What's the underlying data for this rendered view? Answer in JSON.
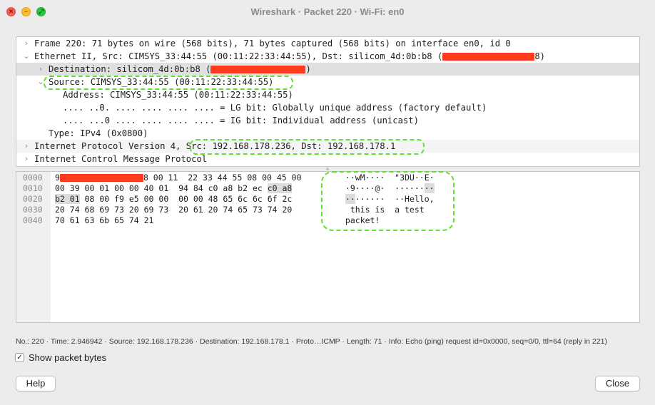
{
  "window": {
    "title": "Wireshark · Packet 220 · Wi-Fi: en0",
    "close_glyph": "✕",
    "minimize_glyph": "−",
    "zoom_glyph": "⤢"
  },
  "colors": {
    "annotation": "#5de02e",
    "redaction": "#ff3b1f",
    "selected_row": "#e0e0e0"
  },
  "details": {
    "rows": [
      {
        "chevron": "›",
        "text": "Frame 220: 71 bytes on wire (568 bits), 71 bytes captured (568 bits) on interface en0, id 0"
      },
      {
        "chevron": "⌄",
        "text": "Ethernet II, Src: CIMSYS_33:44:55 (00:11:22:33:44:55), Dst: silicom_4d:0b:b8 (",
        "suffix": "8)"
      },
      {
        "chevron": "›",
        "text": "Destination: silicom_4d:0b:b8 (",
        "suffix": ")"
      },
      {
        "chevron": "⌄",
        "text": "Source: CIMSYS_33:44:55 (00:11:22:33:44:55)"
      },
      {
        "text": "Address: CIMSYS_33:44:55 (00:11:22:33:44:55)"
      },
      {
        "text": ".... ..0. .... .... .... .... = LG bit: Globally unique address (factory default)"
      },
      {
        "text": ".... ...0 .... .... .... .... = IG bit: Individual address (unicast)"
      },
      {
        "text": "Type: IPv4 (0x0800)"
      },
      {
        "chevron": "›",
        "text": "Internet Protocol Version 4, Src: 192.168.178.236, Dst: 192.168.178.1"
      },
      {
        "chevron": "›",
        "text": "Internet Control Message Protocol"
      }
    ]
  },
  "bytes": {
    "offsets": [
      "0000",
      "0010",
      "0020",
      "0030",
      "0040"
    ],
    "hex": [
      {
        "pre": "9",
        "post": "8 00 11  22 33 44 55 08 00 45 00"
      },
      {
        "pre": "00 39 00 01 00 00 40 01  94 84 c0 a8 b2 ec ",
        "hl": "c0 a8",
        "post": ""
      },
      {
        "pre": "",
        "hl": "b2 01",
        "post": " 08 00 f9 e5 00 00  00 00 48 65 6c 6c 6f 2c"
      },
      {
        "pre": "20 74 68 69 73 20 69 73  20 61 20 74 65 73 74 20",
        "post": ""
      },
      {
        "pre": "70 61 63 6b 65 74 21",
        "post": ""
      }
    ],
    "ascii": [
      {
        "pre": " ··wM····  \"3DU··E·",
        "hl": "",
        "post": ""
      },
      {
        "pre": " ·9····@·  ······",
        "hl": "··",
        "post": ""
      },
      {
        "pre": " ",
        "hl": "··",
        "post": "······  ··Hello,"
      },
      {
        "pre": "  this is  a test",
        "hl": "",
        "post": ""
      },
      {
        "pre": " packet!",
        "hl": "",
        "post": ""
      }
    ]
  },
  "status": {
    "text": "No.: 220 · Time: 2.946942 · Source: 192.168.178.236 · Destination: 192.168.178.1 · Proto…ICMP · Length: 71 · Info: Echo (ping) request id=0x0000, seq=0/0, ttl=64 (reply in 221)"
  },
  "options": {
    "show_bytes_label": "Show packet bytes",
    "show_bytes_checked": true,
    "check_glyph": "✓"
  },
  "buttons": {
    "help": "Help",
    "close": "Close"
  }
}
